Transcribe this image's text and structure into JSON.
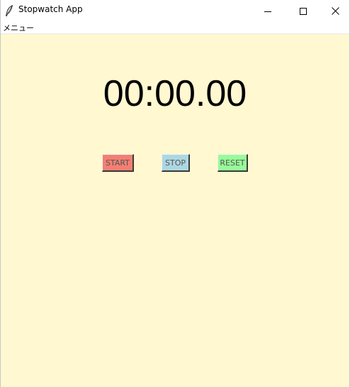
{
  "window": {
    "title": "Stopwatch App"
  },
  "menubar": {
    "items": [
      {
        "label": "メニュー"
      }
    ]
  },
  "stopwatch": {
    "display": "00:00.00",
    "buttons": {
      "start_label": "START",
      "stop_label": "STOP",
      "reset_label": "RESET"
    }
  },
  "colors": {
    "background": "#fff8d0",
    "start_button": "#f47f72",
    "stop_button": "#acd7e2",
    "reset_button": "#98fb98"
  },
  "icons": {
    "app": "feather-icon",
    "minimize": "minimize-icon",
    "maximize": "maximize-icon",
    "close": "close-icon"
  }
}
